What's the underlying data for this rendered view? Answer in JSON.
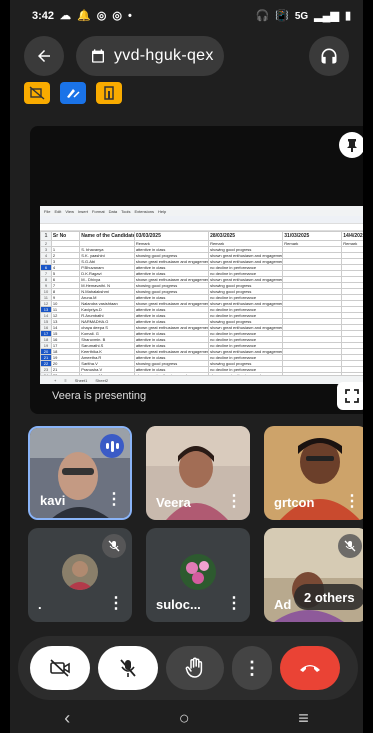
{
  "status_bar": {
    "time": "3:42",
    "network": "5G"
  },
  "meeting": {
    "code": "yvd-hguk-qex"
  },
  "presentation": {
    "presenter_text": "Veera is presenting",
    "sheet": {
      "menu": [
        "File",
        "Edit",
        "View",
        "Insert",
        "Format",
        "Data",
        "Tools",
        "Extensions",
        "Help"
      ],
      "headers": [
        "Sr No",
        "Name of the Candidate",
        "03/03/2025",
        "28/03/2025",
        "31/03/2025",
        "14/4/2025"
      ],
      "subheaders": [
        "",
        "",
        "Remark",
        "Remark",
        "Remark",
        "Remark"
      ],
      "rows": [
        [
          "1",
          "S. bhavanya",
          "attentive in class",
          "showing good progress"
        ],
        [
          "2",
          "S.K. yaashini",
          "showing good progress",
          "shown great enthusiasm and engagement"
        ],
        [
          "3",
          "S.G.Abi",
          "shown great enthusiasm and engagement",
          "shown great enthusiasm and engagement"
        ],
        [
          "4",
          "P.Bhuvanam",
          "attentive in class",
          "no decline in performance"
        ],
        [
          "5",
          "D.K.Ragavi",
          "attentive in class",
          "no decline in performance"
        ],
        [
          "6",
          "M.. Dhivya",
          "shown great enthusiasm and engagement",
          "shown great enthusiasm and engagement"
        ],
        [
          "7",
          "M.Hemavathi. N",
          "showing good progress",
          "showing good progress"
        ],
        [
          "8",
          "N.Mahalakshmi",
          "showing good progress",
          "showing good progress"
        ],
        [
          "9",
          "Aruna.M",
          "attentive in class",
          "no decline in performance"
        ],
        [
          "10",
          "Nalandra vasishtaan",
          "shown great enthusiasm and engagement",
          "shown great enthusiasm and engagement"
        ],
        [
          "11",
          "Kavipriya.D",
          "attentive in class",
          "no decline in performance"
        ],
        [
          "12",
          "R.Arumbathi",
          "attentive in class",
          "no decline in performance"
        ],
        [
          "13",
          "NARMADHA.G",
          "attentive in class",
          "showing good progress"
        ],
        [
          "14",
          "chaya deepa S",
          "shown great enthusiasm and engagement",
          "shown great enthusiasm and engagement"
        ],
        [
          "15",
          "Komali. G",
          "attentive in class",
          "no decline in performance"
        ],
        [
          "16",
          "Sharuvmin. B",
          "attentive in class",
          "no decline in performance"
        ],
        [
          "17",
          "Sarumathi.S",
          "attentive in class",
          "no decline in performance"
        ],
        [
          "18",
          "Keerthika.K",
          "shown great enthusiasm and engagement",
          "shown great enthusiasm and engagement"
        ],
        [
          "19",
          "Ameetha.R",
          "attentive in class",
          "no decline in performance"
        ],
        [
          "20",
          "Saritha.V",
          "showing good progress",
          "showing good progress"
        ],
        [
          "21",
          "Pranusha.V",
          "attentive in class",
          "no decline in performance"
        ],
        [
          "22",
          "Lavanya. M",
          "shown great enthusiasm and engagement",
          "shown great enthusiasm and engagement"
        ],
        [
          "23",
          "Jeevitha. R",
          "attentive in class",
          "no decline in performance"
        ]
      ]
    }
  },
  "participants": [
    {
      "name": "kavi",
      "muted": false,
      "speaking": true
    },
    {
      "name": "Veera",
      "muted": false,
      "speaking": false
    },
    {
      "name": "grtcon",
      "muted": false,
      "speaking": false
    },
    {
      "name": ".",
      "muted": true,
      "speaking": false
    },
    {
      "name": "suloc...",
      "muted": false,
      "speaking": false
    },
    {
      "name": "Ad",
      "muted": true,
      "speaking": false
    }
  ],
  "others_label": "2 others",
  "colors": {
    "accent_blue": "#8ab4f8",
    "end_call_red": "#ea4335",
    "activity_yellow": "#f9ab00",
    "sheet_selection": "#1a56c7"
  }
}
